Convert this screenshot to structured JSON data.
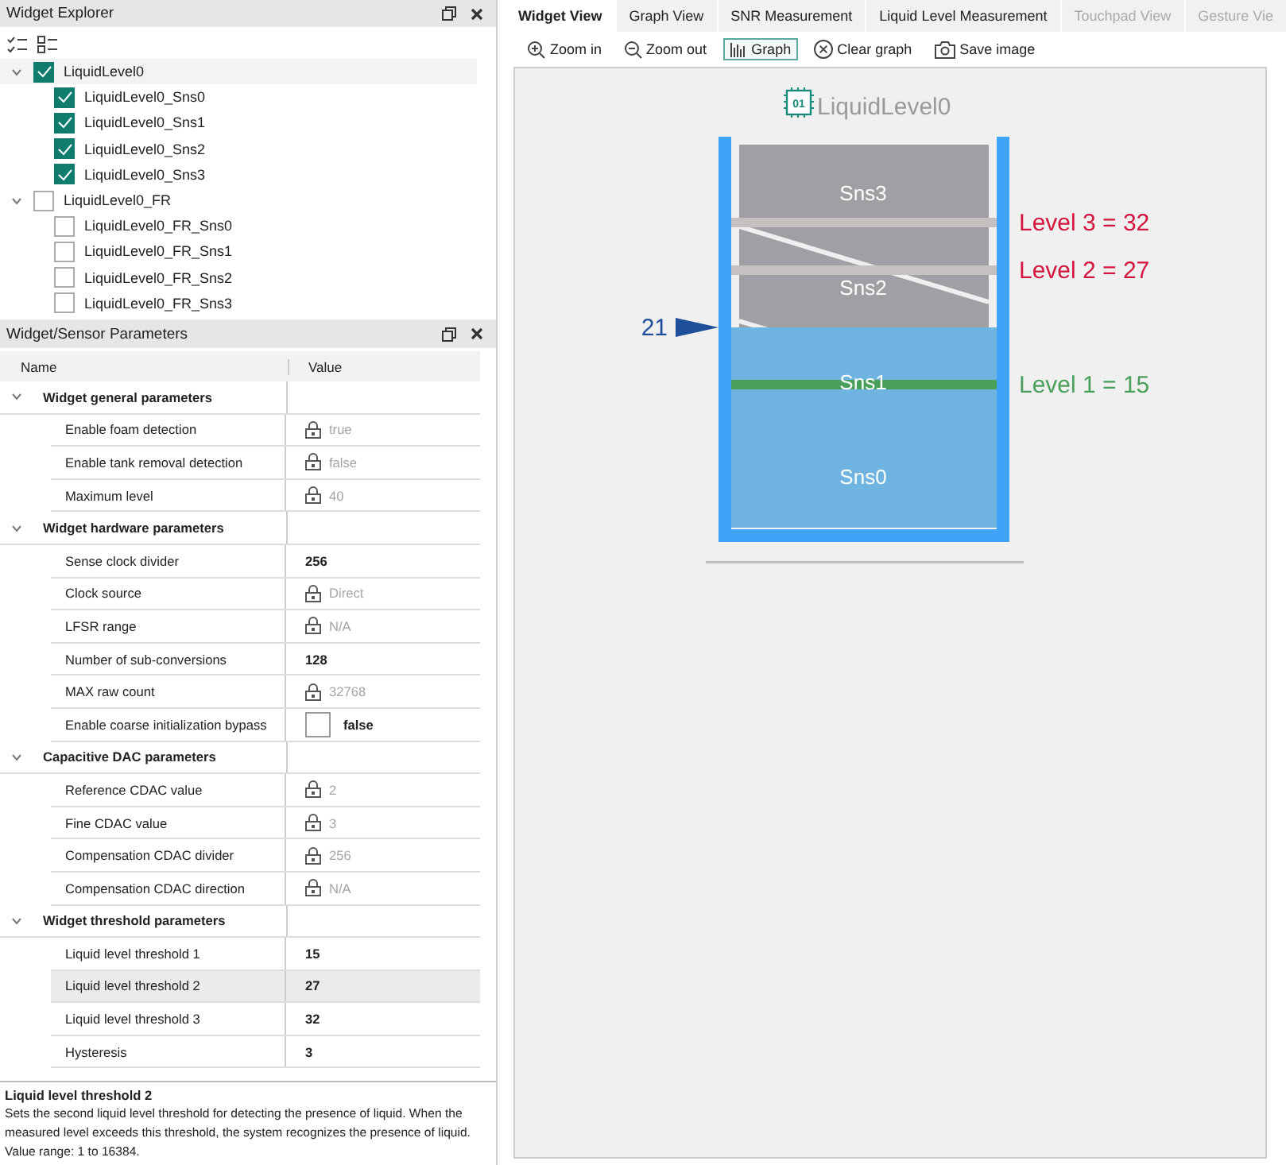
{
  "widget_explorer": {
    "title": "Widget Explorer",
    "tree": [
      {
        "label": "LiquidLevel0",
        "checked": true,
        "expanded": true,
        "selected": true,
        "children": [
          {
            "label": "LiquidLevel0_Sns0",
            "checked": true,
            "selected": false
          },
          {
            "label": "LiquidLevel0_Sns1",
            "checked": true,
            "selected": false
          },
          {
            "label": "LiquidLevel0_Sns2",
            "checked": true,
            "selected": false
          },
          {
            "label": "LiquidLevel0_Sns3",
            "checked": true,
            "selected": false
          }
        ]
      },
      {
        "label": "LiquidLevel0_FR",
        "checked": false,
        "expanded": true,
        "selected": false,
        "children": [
          {
            "label": "LiquidLevel0_FR_Sns0",
            "checked": false,
            "selected": false
          },
          {
            "label": "LiquidLevel0_FR_Sns1",
            "checked": false,
            "selected": false
          },
          {
            "label": "LiquidLevel0_FR_Sns2",
            "checked": false,
            "selected": false
          },
          {
            "label": "LiquidLevel0_FR_Sns3",
            "checked": false,
            "selected": false
          }
        ]
      }
    ]
  },
  "parameters": {
    "title": "Widget/Sensor Parameters",
    "columns": [
      "Name",
      "Value"
    ],
    "groups": [
      {
        "label": "Widget general parameters",
        "expanded": true,
        "rows": [
          {
            "name": "Enable foam detection",
            "value": "true",
            "locked": true,
            "kind": "text",
            "selected": false
          },
          {
            "name": "Enable tank removal detection",
            "value": "false",
            "locked": true,
            "kind": "text",
            "selected": false
          },
          {
            "name": "Maximum level",
            "value": "40",
            "locked": true,
            "kind": "text",
            "selected": false
          }
        ]
      },
      {
        "label": "Widget hardware parameters",
        "expanded": true,
        "rows": [
          {
            "name": "Sense clock divider",
            "value": "256",
            "locked": false,
            "kind": "text",
            "selected": false
          },
          {
            "name": "Clock source",
            "value": "Direct",
            "locked": true,
            "kind": "text",
            "selected": false
          },
          {
            "name": "LFSR range",
            "value": "N/A",
            "locked": true,
            "kind": "text",
            "selected": false
          },
          {
            "name": "Number of sub-conversions",
            "value": "128",
            "locked": false,
            "kind": "text",
            "selected": false
          },
          {
            "name": "MAX raw count",
            "value": "32768",
            "locked": true,
            "kind": "text",
            "selected": false
          },
          {
            "name": "Enable coarse initialization bypass",
            "value": "false",
            "locked": false,
            "kind": "checkbox",
            "checked": false,
            "selected": false
          }
        ]
      },
      {
        "label": "Capacitive DAC parameters",
        "expanded": true,
        "rows": [
          {
            "name": "Reference CDAC value",
            "value": "2",
            "locked": true,
            "kind": "text",
            "selected": false
          },
          {
            "name": "Fine CDAC value",
            "value": "3",
            "locked": true,
            "kind": "text",
            "selected": false
          },
          {
            "name": "Compensation CDAC divider",
            "value": "256",
            "locked": true,
            "kind": "text",
            "selected": false
          },
          {
            "name": "Compensation CDAC direction",
            "value": "N/A",
            "locked": true,
            "kind": "text",
            "selected": false
          }
        ]
      },
      {
        "label": "Widget threshold parameters",
        "expanded": true,
        "rows": [
          {
            "name": "Liquid level threshold 1",
            "value": "15",
            "locked": false,
            "kind": "text",
            "selected": false
          },
          {
            "name": "Liquid level threshold 2",
            "value": "27",
            "locked": false,
            "kind": "text",
            "selected": true
          },
          {
            "name": "Liquid level threshold 3",
            "value": "32",
            "locked": false,
            "kind": "text",
            "selected": false
          },
          {
            "name": "Hysteresis",
            "value": "3",
            "locked": false,
            "kind": "text",
            "selected": false
          }
        ]
      }
    ]
  },
  "description": {
    "title": "Liquid level threshold 2",
    "text": "Sets the second liquid level threshold for detecting the presence of liquid. When the measured level exceeds this threshold, the system recognizes the presence of liquid.",
    "range": "Value range: 1 to 16384."
  },
  "tabs": [
    {
      "label": "Widget View",
      "selected": true,
      "disabled": false
    },
    {
      "label": "Graph View",
      "selected": false,
      "disabled": false
    },
    {
      "label": "SNR Measurement",
      "selected": false,
      "disabled": false
    },
    {
      "label": "Liquid Level Measurement",
      "selected": false,
      "disabled": false
    },
    {
      "label": "Touchpad View",
      "selected": false,
      "disabled": true
    },
    {
      "label": "Gesture Vie",
      "selected": false,
      "disabled": true
    }
  ],
  "toolbar": [
    {
      "label": "Zoom in",
      "kind": "zoom-in",
      "selected": false
    },
    {
      "label": "Zoom out",
      "kind": "zoom-out",
      "selected": false
    },
    {
      "label": "Graph",
      "kind": "graph",
      "selected": true
    },
    {
      "label": "Clear graph",
      "kind": "clear",
      "selected": false
    },
    {
      "label": "Save image",
      "kind": "camera",
      "selected": false
    }
  ],
  "tank": {
    "chip_label": "01",
    "widget": "LiquidLevel0",
    "level": 0.525,
    "reading": "21",
    "sensors": [
      "Sns3",
      "Sns2",
      "Sns1",
      "Sns0"
    ],
    "thresholds": [
      {
        "label": "Level 3 = 32",
        "level": 0.8,
        "reached": false
      },
      {
        "label": "Level 2 = 27",
        "level": 0.675,
        "reached": false
      },
      {
        "label": "Level 1 = 15",
        "level": 0.375,
        "reached": true
      }
    ]
  }
}
